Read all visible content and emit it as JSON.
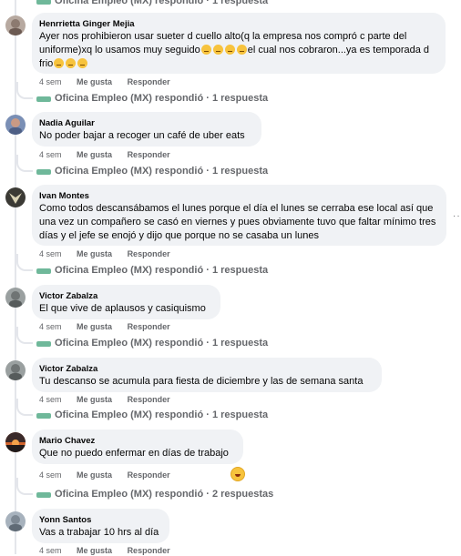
{
  "top_reply": {
    "text": "Oficina Empleo (MX) respondió · 1 respuesta"
  },
  "action_labels": {
    "like": "Me gusta",
    "reply": "Responder"
  },
  "more_label": "··",
  "comments": [
    {
      "author": "Henrrietta Ginger Mejia",
      "text": "Ayer nos prohibieron usar sueter d cuello alto(q la empresa nos compró c parte del uniforme)xq lo usamos muy seguido",
      "text_after_emoji": "el cual nos cobraron...ya es temporada d frio",
      "time": "4 sem",
      "reply_text": "Oficina Empleo (MX) respondió · 1 respuesta",
      "avatar_color": "#b7a9a0"
    },
    {
      "author": "Nadia Aguilar",
      "text": "No poder bajar a recoger un café de uber eats",
      "time": "4 sem",
      "reply_text": "Oficina Empleo (MX) respondió · 1 respuesta",
      "avatar_color": "#7a8fb5"
    },
    {
      "author": "Ivan Montes",
      "text": "Como todos descansábamos el lunes porque el día el lunes se cerraba ese local así que una vez un compañero se casó en viernes y pues obviamente tuvo que faltar mínimo tres días y el jefe se enojó y dijo que porque no se casaba un lunes",
      "time": "4 sem",
      "reply_text": "Oficina Empleo (MX) respondió · 1 respuesta",
      "avatar_color": "#3b3a35"
    },
    {
      "author": "Victor Zabalza",
      "text": "El que vive de aplausos y casiquismo",
      "time": "4 sem",
      "reply_text": "Oficina Empleo (MX) respondió · 1 respuesta",
      "avatar_color": "#9aa0a0"
    },
    {
      "author": "Victor Zabalza",
      "text": "Tu descanso se acumula para fiesta de diciembre y las de semana santa",
      "time": "4 sem",
      "reply_text": "Oficina Empleo (MX) respondió · 1 respuesta",
      "avatar_color": "#9aa0a0"
    },
    {
      "author": "Mario Chavez",
      "text": "Que no puedo enfermar en días de trabajo",
      "time": "4 sem",
      "reply_text": "Oficina Empleo (MX) respondió · 2 respuestas",
      "avatar_color": "#d1632c"
    },
    {
      "author": "Yonn Santos",
      "text": "Vas a trabajar 10 hrs al día",
      "time": "4 sem",
      "avatar_color": "#a7b2bd"
    }
  ]
}
